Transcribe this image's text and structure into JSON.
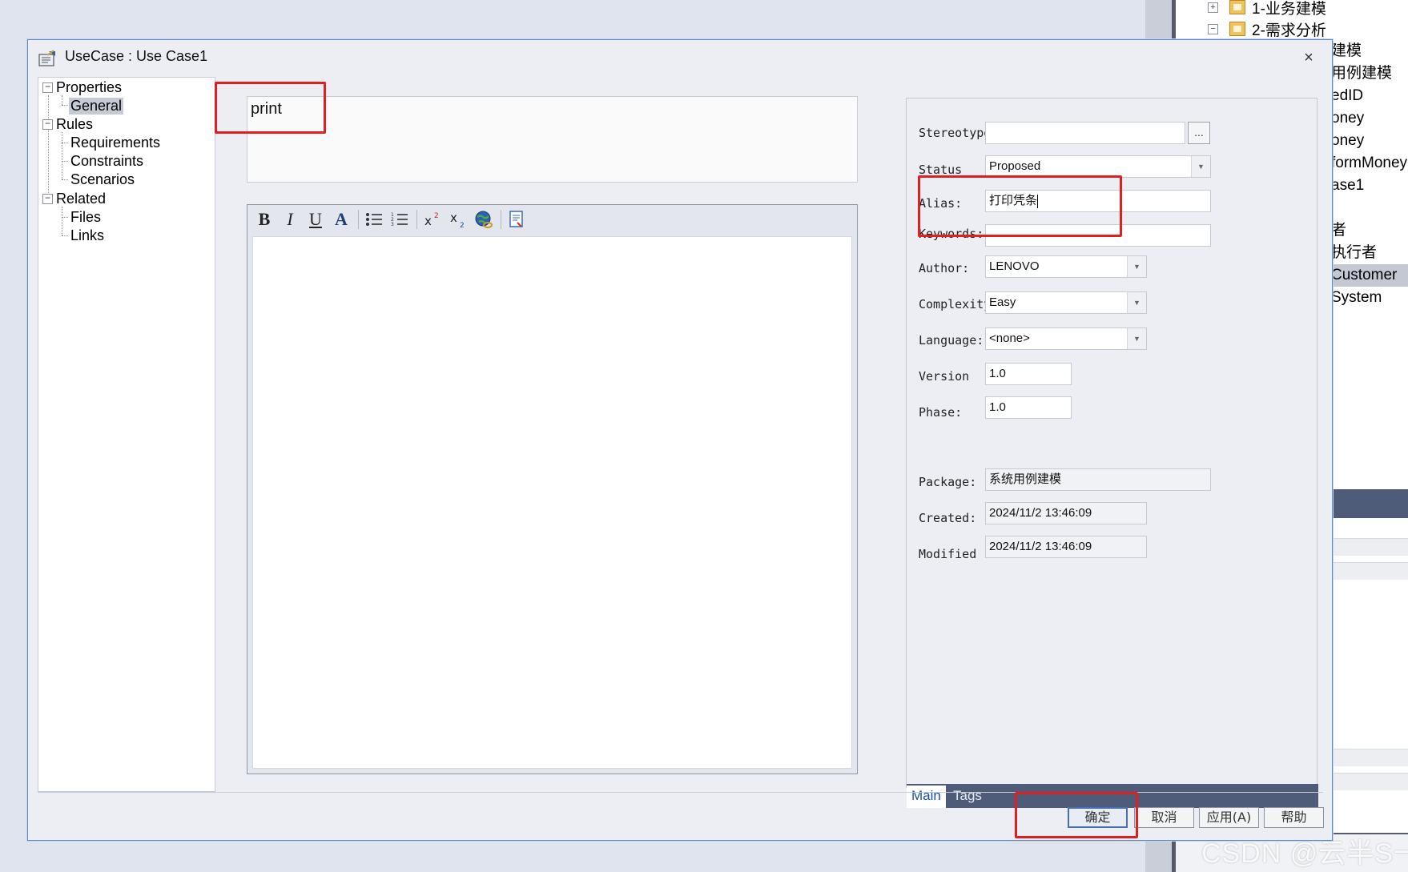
{
  "background_app": {
    "tree": [
      {
        "toggle": "+",
        "label": "1-业务建模"
      },
      {
        "toggle": "−",
        "label": "2-需求分析"
      }
    ],
    "list": [
      "建模",
      "用例建模",
      "edID",
      "oney",
      "oney",
      "formMoney",
      "ase1",
      "",
      "者",
      "执行者",
      "Customer",
      "System"
    ]
  },
  "watermark": "CSDN @云半S一",
  "dialog": {
    "title": "UseCase : Use Case1",
    "close_glyph": "×",
    "nav_tree": {
      "properties": {
        "label": "Properties",
        "toggle": "−",
        "children": [
          "General"
        ]
      },
      "rules": {
        "label": "Rules",
        "toggle": "−",
        "children": [
          "Requirements",
          "Constraints",
          "Scenarios"
        ]
      },
      "related": {
        "label": "Related",
        "toggle": "−",
        "children": [
          "Files",
          "Links"
        ]
      },
      "selected": "General"
    },
    "name_value": "print",
    "editor_toolbar": {
      "bold": "B",
      "italic": "I",
      "underline": "U",
      "font_color": "A",
      "bullet_list": "☰",
      "numbered_list": "☰",
      "superscript": "x",
      "subscript": "x",
      "hyperlink": "",
      "insert_doc": ""
    },
    "fields": {
      "stereotype": {
        "label": "Stereotype",
        "value": "",
        "button": "..."
      },
      "status": {
        "label": "Status",
        "value": "Proposed"
      },
      "alias": {
        "label": "Alias:",
        "value": "打印凭条"
      },
      "keywords": {
        "label": "Keywords:",
        "value": ""
      },
      "author": {
        "label": "Author:",
        "value": "LENOVO"
      },
      "complexity": {
        "label": "Complexity",
        "value": "Easy"
      },
      "language": {
        "label": "Language:",
        "value": "<none>"
      },
      "version": {
        "label": "Version",
        "value": "1.0"
      },
      "phase": {
        "label": "Phase:",
        "value": "1.0"
      },
      "package": {
        "label": "Package:",
        "value": "系统用例建模"
      },
      "created": {
        "label": "Created:",
        "value": "2024/11/2 13:46:09"
      },
      "modified": {
        "label": "Modified",
        "value": "2024/11/2 13:46:09"
      }
    },
    "tabs": [
      "Main",
      "Tags"
    ],
    "active_tab": "Main",
    "buttons": {
      "ok": "确定",
      "cancel": "取消",
      "apply": "应用(A)",
      "help": "帮助"
    }
  },
  "colors": {
    "annotation_red": "#e02020",
    "tabbar": "#4e5c7a",
    "dialog_border": "#5b8bc9"
  }
}
